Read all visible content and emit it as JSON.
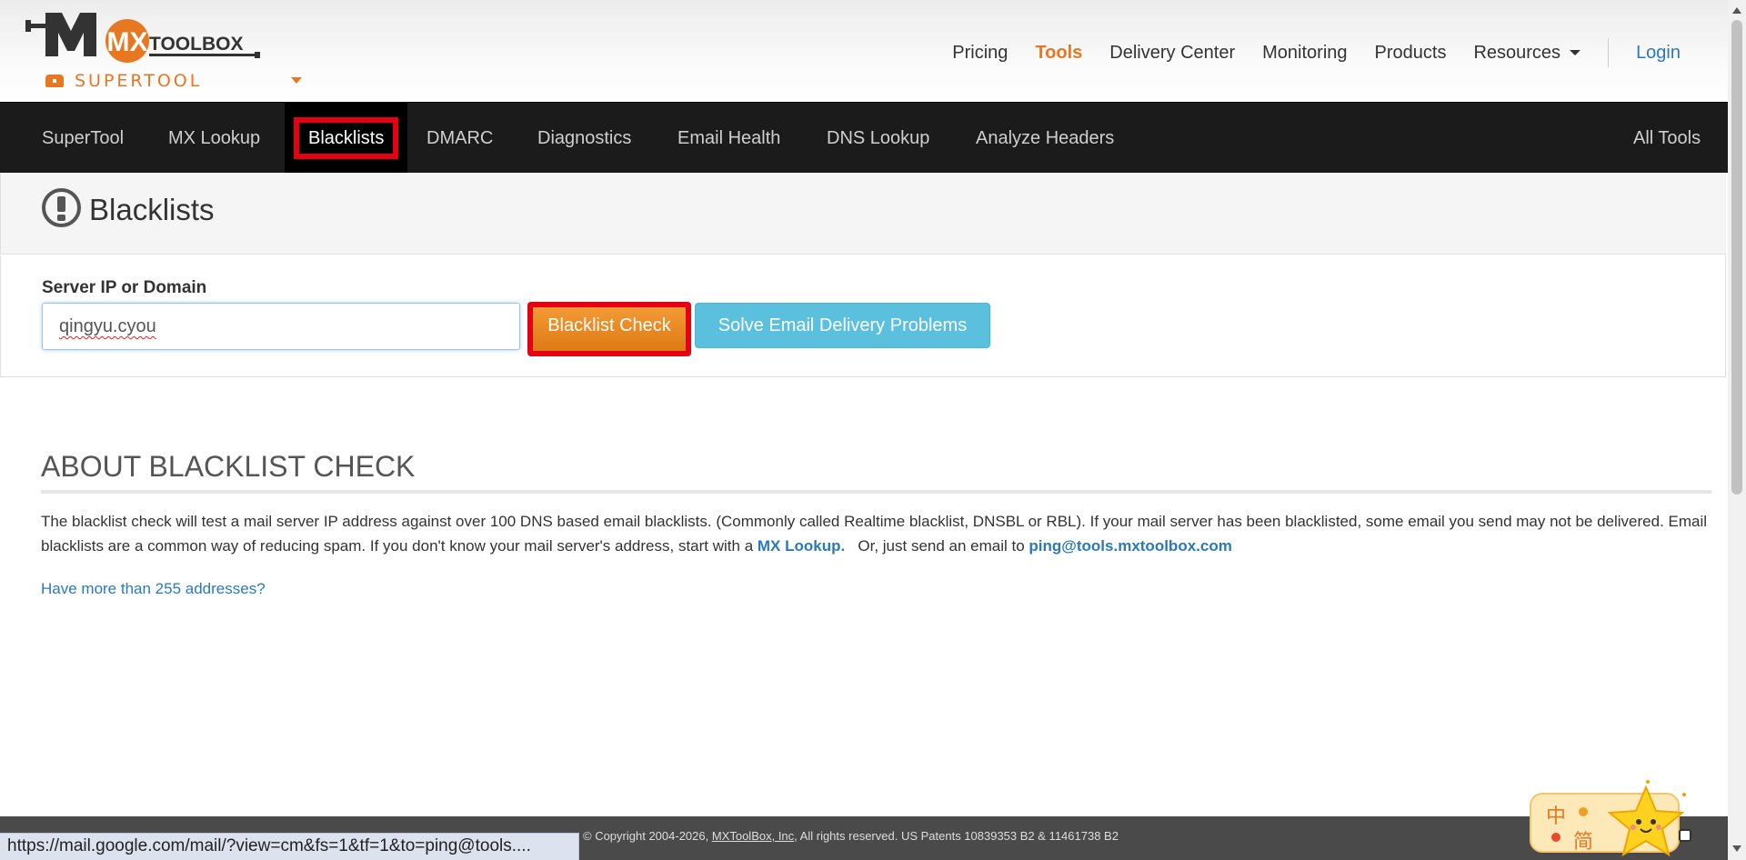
{
  "brand": {
    "logo_text": "TOOLBOX",
    "logo_letters": "MX",
    "supertool_label": "SUPERTOOL",
    "accent": "#e87722"
  },
  "topnav": {
    "items": [
      {
        "label": "Pricing",
        "active": false
      },
      {
        "label": "Tools",
        "active": true
      },
      {
        "label": "Delivery Center",
        "active": false
      },
      {
        "label": "Monitoring",
        "active": false
      },
      {
        "label": "Products",
        "active": false
      },
      {
        "label": "Resources",
        "active": false
      }
    ],
    "login_label": "Login"
  },
  "toolbar": {
    "items": [
      {
        "label": "SuperTool"
      },
      {
        "label": "MX Lookup"
      },
      {
        "label": "Blacklists"
      },
      {
        "label": "DMARC"
      },
      {
        "label": "Diagnostics"
      },
      {
        "label": "Email Health"
      },
      {
        "label": "DNS Lookup"
      },
      {
        "label": "Analyze Headers"
      }
    ],
    "all_tools_label": "All Tools",
    "active_item": "Blacklists"
  },
  "page": {
    "title": "Blacklists",
    "title_icon": "exclamation-circle-icon"
  },
  "form": {
    "label": "Server IP or Domain",
    "input_value": "qingyu.cyou",
    "check_button": "Blacklist Check",
    "solve_button": "Solve Email Delivery Problems"
  },
  "about": {
    "heading": "ABOUT BLACKLIST CHECK",
    "text_part1": "The blacklist check will test a mail server IP address against over 100 DNS based email blacklists. (Commonly called Realtime blacklist, DNSBL or RBL).  If your mail server has been blacklisted, some email you send may not be delivered.  Email blacklists are a common way of reducing spam.  If you don't know your mail server's address, start with a ",
    "mx_link": "MX Lookup.",
    "text_part2": "   Or, just send an email to ",
    "email_link": "ping@tools.mxtoolbox.com",
    "more_link": "Have more than 255 addresses?"
  },
  "footer": {
    "copyright_prefix": "© Copyright 2004-2026, ",
    "company_link": "MXToolBox, Inc",
    "copyright_suffix": ", All rights reserved. US Patents 10839353 B2 & 11461738 B2"
  },
  "status_bar": {
    "url": "https://mail.google.com/mail/?view=cm&fs=1&tf=1&to=ping@tools...."
  },
  "ime": {
    "lang_char": "中",
    "mode_char": "简"
  },
  "colors": {
    "toolbar_bg": "#1b1b1b",
    "highlight": "#e60012",
    "link": "#2a7ab8",
    "solve_button": "#5bc0de"
  }
}
